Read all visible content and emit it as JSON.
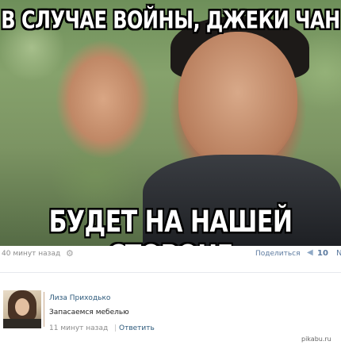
{
  "meme": {
    "caption_top": "В СЛУЧАЕ ВОЙНЫ, ДЖЕКИ ЧАН",
    "caption_bottom": "БУДЕТ НА НАШЕЙ СТОРОНЕ"
  },
  "post": {
    "time": "40 минут назад",
    "settings_icon": "gear-icon",
    "share_label": "Поделиться",
    "share_icon": "megaphone-icon",
    "share_count": "10",
    "more_letter": "N"
  },
  "comment": {
    "author": "Лиза Приходько",
    "text": "Запасаемся мебелью",
    "time": "11 минут назад",
    "separator": "|",
    "reply_label": "Ответить"
  },
  "watermark": "pikabu.ru",
  "colors": {
    "link": "#2b587a",
    "muted": "#8b8b8b",
    "share_accent": "#5c7a9f"
  }
}
